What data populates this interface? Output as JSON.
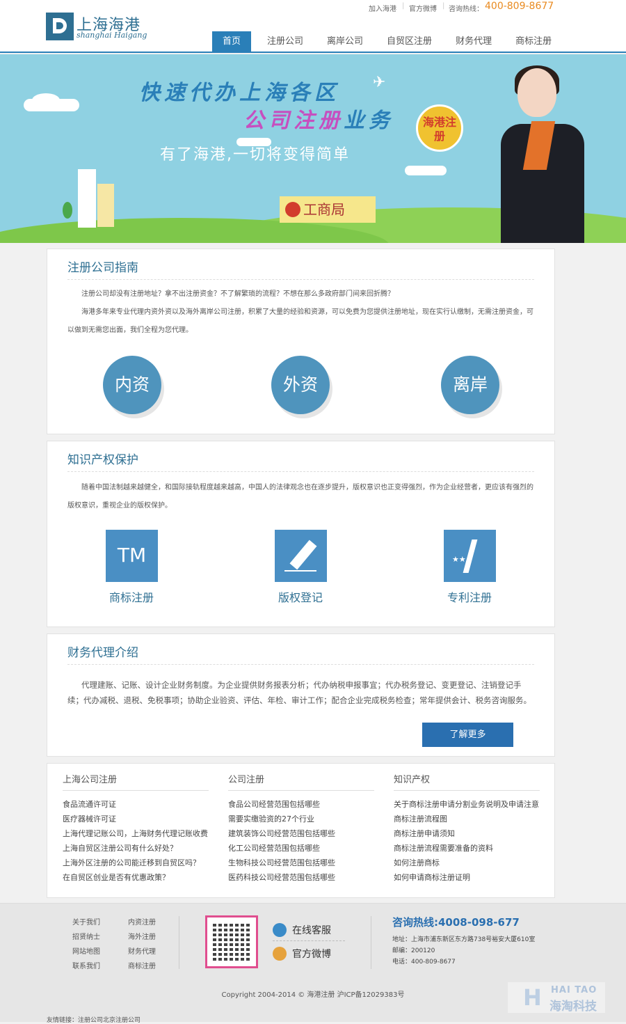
{
  "header": {
    "logo_cn": "上海海港",
    "logo_en": "shanghai Haigang",
    "top_links": [
      "加入海港",
      "官方微博"
    ],
    "hotline_label": "咨询热线：",
    "hotline_number": "400-809-8677",
    "nav": [
      "首页",
      "注册公司",
      "离岸公司",
      "自贸区注册",
      "财务代理",
      "商标注册"
    ],
    "nav_active": "首页"
  },
  "banner": {
    "title1": "快速代办上海各区",
    "title2_a": "公司注册",
    "title2_b": "业务",
    "subtitle": "有了海港,一切将变得简单",
    "badge": "海港注册",
    "sign": "工商局"
  },
  "guide": {
    "title": "注册公司指南",
    "p1": "注册公司却没有注册地址？拿不出注册资金？不了解繁琐的流程？不想在那么多政府部门间来回折腾？",
    "p2": "海港多年来专业代理内资外资以及海外离岸公司注册，积累了大量的经验和资源，可以免费为您提供注册地址，现在实行认缴制，无需注册资金，可以做到无需您出面，我们全程为您代理。",
    "circles": [
      "内资",
      "外资",
      "离岸"
    ]
  },
  "ip": {
    "title": "知识产权保护",
    "p1": "随着中国法制越来越健全，和国际接轨程度越来越高，中国人的法律观念也在逐步提升，版权意识也正变得强烈，作为企业经营者，更应该有强烈的版权意识，重视企业的版权保护。",
    "tm_text": "TM",
    "items": [
      "商标注册",
      "版权登记",
      "专利注册"
    ]
  },
  "finance": {
    "title": "财务代理介绍",
    "p1": "代理建账、记账、设计企业财务制度。为企业提供财务报表分析；代办纳税申报事宜；代办税务登记、变更登记、注销登记手续；代办减税、退税、免税事项；协助企业验资、评估、年检、审计工作；配合企业完成税务检查；常年提供会计、税务咨询服务。",
    "more": "了解更多"
  },
  "links": {
    "col1_title": "上海公司注册",
    "col1": [
      "食品流通许可证",
      "医疗器械许可证",
      "上海代理记账公司，上海财务代理记账收费",
      "上海自贸区注册公司有什么好处？",
      "上海外区注册的公司能迁移到自贸区吗？",
      "在自贸区创业是否有优惠政策？"
    ],
    "col2_title": "公司注册",
    "col2": [
      "食品公司经营范围包括哪些",
      "需要实缴验资的27个行业",
      "建筑装饰公司经营范围包括哪些",
      "化工公司经营范围包括哪些",
      "生物科技公司经营范围包括哪些",
      "医药科技公司经营范围包括哪些"
    ],
    "col3_title": "知识产权",
    "col3": [
      "关于商标注册申请分割业务说明及申请注意",
      "商标注册流程图",
      "商标注册申请须知",
      "商标注册流程需要准备的资料",
      "如何注册商标",
      "如何申请商标注册证明"
    ]
  },
  "footer": {
    "links": [
      "关于我们",
      "内资注册",
      "招贤纳士",
      "海外注册",
      "网站地图",
      "财务代理",
      "联系我们",
      "商标注册"
    ],
    "online_service": "在线客服",
    "weibo": "官方微博",
    "hotline": "咨询热线:4008-098-677",
    "address": "地址：上海市浦东新区东方路738号裕安大厦610室",
    "postcode": "邮编：200120",
    "phone": "电话：400-809-8677",
    "copyright": "Copyright 2004-2014 © 海港注册 沪ICP备12029383号",
    "friends": "友情链接：注册公司北京注册公司",
    "watermark_en": "HAI TAO",
    "watermark_cn": "海淘科技"
  }
}
